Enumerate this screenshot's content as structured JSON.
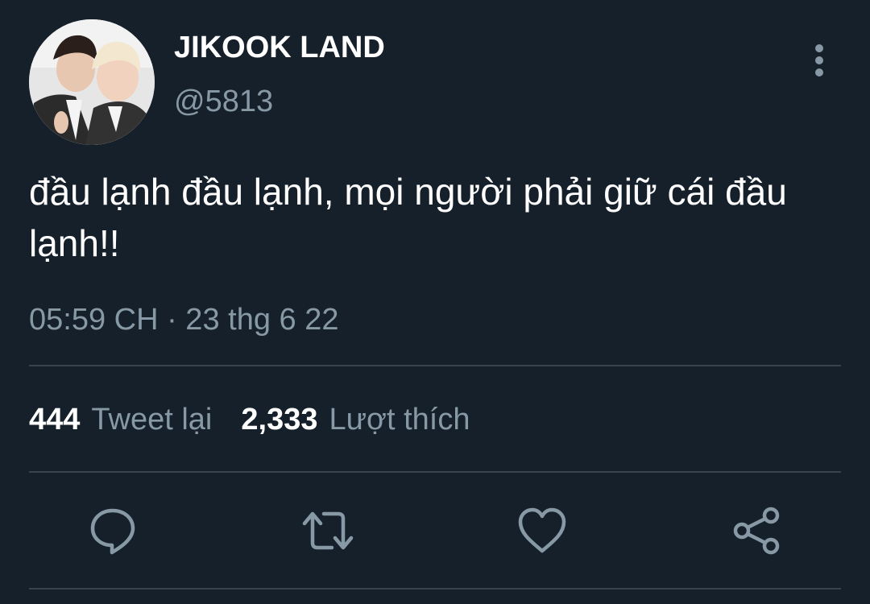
{
  "tweet": {
    "display_name": "JIKOOK LAND",
    "handle": "@5813",
    "text": "đầu lạnh đầu lạnh, mọi người phải giữ cái đầu lạnh!!",
    "timestamp": "05:59 CH · 23 thg 6 22"
  },
  "stats": {
    "retweets_count": "444",
    "retweets_label": "Tweet lại",
    "likes_count": "2,333",
    "likes_label": "Lượt thích"
  },
  "icons": {
    "more": "more-vertical-icon",
    "reply": "reply-icon",
    "retweet": "retweet-icon",
    "like": "heart-icon",
    "share": "share-icon"
  },
  "colors": {
    "background": "#15202b",
    "secondary_text": "#8899a6",
    "divider": "#38444d",
    "icon": "#8899a6"
  }
}
